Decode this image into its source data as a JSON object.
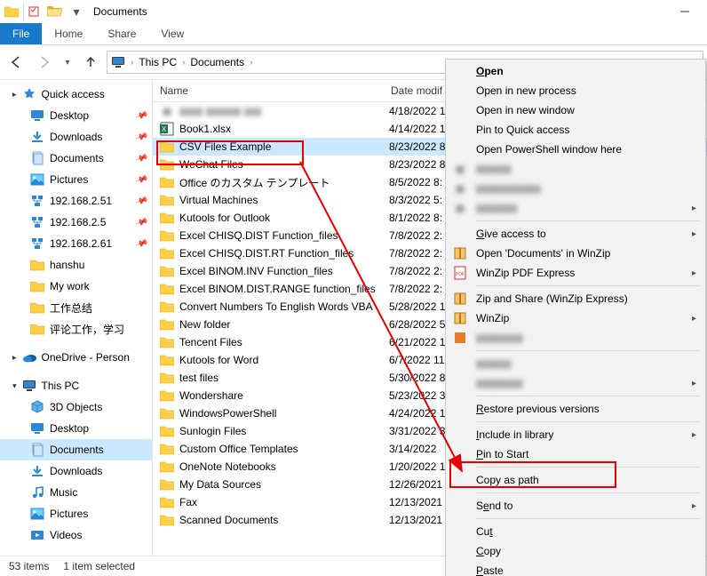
{
  "title": "Documents",
  "ribbon_tabs": {
    "file": "File",
    "home": "Home",
    "share": "Share",
    "view": "View"
  },
  "breadcrumb": {
    "pc": "This PC",
    "folder": "Documents"
  },
  "columns": {
    "name": "Name",
    "date": "Date modif"
  },
  "sidebar": {
    "quick_access": "Quick access",
    "items": [
      {
        "label": "Desktop",
        "icon": "desktop",
        "pinned": true
      },
      {
        "label": "Downloads",
        "icon": "downloads",
        "pinned": true
      },
      {
        "label": "Documents",
        "icon": "documents",
        "pinned": true
      },
      {
        "label": "Pictures",
        "icon": "pictures",
        "pinned": true
      },
      {
        "label": "192.168.2.51",
        "icon": "network",
        "pinned": true
      },
      {
        "label": "192.168.2.5",
        "icon": "network",
        "pinned": true
      },
      {
        "label": "192.168.2.61",
        "icon": "network",
        "pinned": true
      },
      {
        "label": "hanshu",
        "icon": "folder",
        "pinned": false
      },
      {
        "label": "My work",
        "icon": "folder",
        "pinned": false
      },
      {
        "label": "工作总结",
        "icon": "folder",
        "pinned": false
      },
      {
        "label": "评论工作，学习",
        "icon": "folder",
        "pinned": false
      }
    ],
    "onedrive": "OneDrive - Person",
    "this_pc": "This PC",
    "pc_items": [
      {
        "label": "3D Objects",
        "icon": "3d"
      },
      {
        "label": "Desktop",
        "icon": "desktop"
      },
      {
        "label": "Documents",
        "icon": "documents",
        "selected": true
      },
      {
        "label": "Downloads",
        "icon": "downloads"
      },
      {
        "label": "Music",
        "icon": "music"
      },
      {
        "label": "Pictures",
        "icon": "pictures"
      },
      {
        "label": "Videos",
        "icon": "videos"
      }
    ]
  },
  "rows": [
    {
      "name": "",
      "date": "4/18/2022 1",
      "icon": "blur",
      "blur": true
    },
    {
      "name": "Book1.xlsx",
      "date": "4/14/2022 1",
      "icon": "excel"
    },
    {
      "name": "CSV Files Example",
      "date": "8/23/2022 8",
      "icon": "folder",
      "selected": true
    },
    {
      "name": "WeChat Files",
      "date": "8/23/2022 8",
      "icon": "folder"
    },
    {
      "name": "Office のカスタム テンプレート",
      "date": "8/5/2022 8:",
      "icon": "folder"
    },
    {
      "name": "Virtual Machines",
      "date": "8/3/2022 5:",
      "icon": "folder"
    },
    {
      "name": "Kutools for Outlook",
      "date": "8/1/2022 8:",
      "icon": "folder"
    },
    {
      "name": "Excel CHISQ.DIST Function_files",
      "date": "7/8/2022 2:",
      "icon": "folder"
    },
    {
      "name": "Excel CHISQ.DIST.RT Function_files",
      "date": "7/8/2022 2:",
      "icon": "folder"
    },
    {
      "name": "Excel BINOM.INV Function_files",
      "date": "7/8/2022 2:",
      "icon": "folder"
    },
    {
      "name": "Excel BINOM.DIST.RANGE function_files",
      "date": "7/8/2022 2:",
      "icon": "folder"
    },
    {
      "name": "Convert Numbers To English Words VBA",
      "date": "5/28/2022 1",
      "icon": "folder"
    },
    {
      "name": "New folder",
      "date": "6/28/2022 5",
      "icon": "folder"
    },
    {
      "name": "Tencent Files",
      "date": "6/21/2022 1",
      "icon": "folder"
    },
    {
      "name": "Kutools for Word",
      "date": "6/7/2022 11",
      "icon": "folder"
    },
    {
      "name": "test files",
      "date": "5/30/2022 8",
      "icon": "folder"
    },
    {
      "name": "Wondershare",
      "date": "5/23/2022 3",
      "icon": "folder"
    },
    {
      "name": "WindowsPowerShell",
      "date": "4/24/2022 1",
      "icon": "folder"
    },
    {
      "name": "Sunlogin Files",
      "date": "3/31/2022 3",
      "icon": "folder"
    },
    {
      "name": "Custom Office Templates",
      "date": "3/14/2022",
      "icon": "folder"
    },
    {
      "name": "OneNote Notebooks",
      "date": "1/20/2022 1",
      "icon": "folder"
    },
    {
      "name": "My Data Sources",
      "date": "12/26/2021",
      "icon": "folder"
    },
    {
      "name": "Fax",
      "date": "12/13/2021",
      "icon": "folder"
    },
    {
      "name": "Scanned Documents",
      "date": "12/13/2021",
      "icon": "folder"
    }
  ],
  "status": {
    "items": "53 items",
    "selected": "1 item selected"
  },
  "context_menu": {
    "open": "Open",
    "open_new_process": "Open in new process",
    "open_new_window": "Open in new window",
    "pin_quick": "Pin to Quick access",
    "open_ps": "Open PowerShell window here",
    "blur1": "▮▮▮▮▮▮",
    "blur2": "▮▮▮▮▮▮▮▮▮▮▮",
    "blur3": "▮▮▮▮▮▮▮",
    "give_access": "Give access to",
    "open_docs_winzip": "Open 'Documents' in WinZip",
    "winzip_pdf": "WinZip PDF Express",
    "zip_share": "Zip and Share (WinZip Express)",
    "winzip": "WinZip",
    "blur4": "▮▮▮▮▮▮▮▮",
    "blur5": "▮▮▮▮▮▮",
    "blur6": "▮▮▮▮▮▮▮▮",
    "restore_prev": "Restore previous versions",
    "include_lib": "Include in library",
    "pin_start": "Pin to Start",
    "copy_path": "Copy as path",
    "send_to": "Send to",
    "cut": "Cut",
    "copy": "Copy",
    "paste": "Paste"
  }
}
